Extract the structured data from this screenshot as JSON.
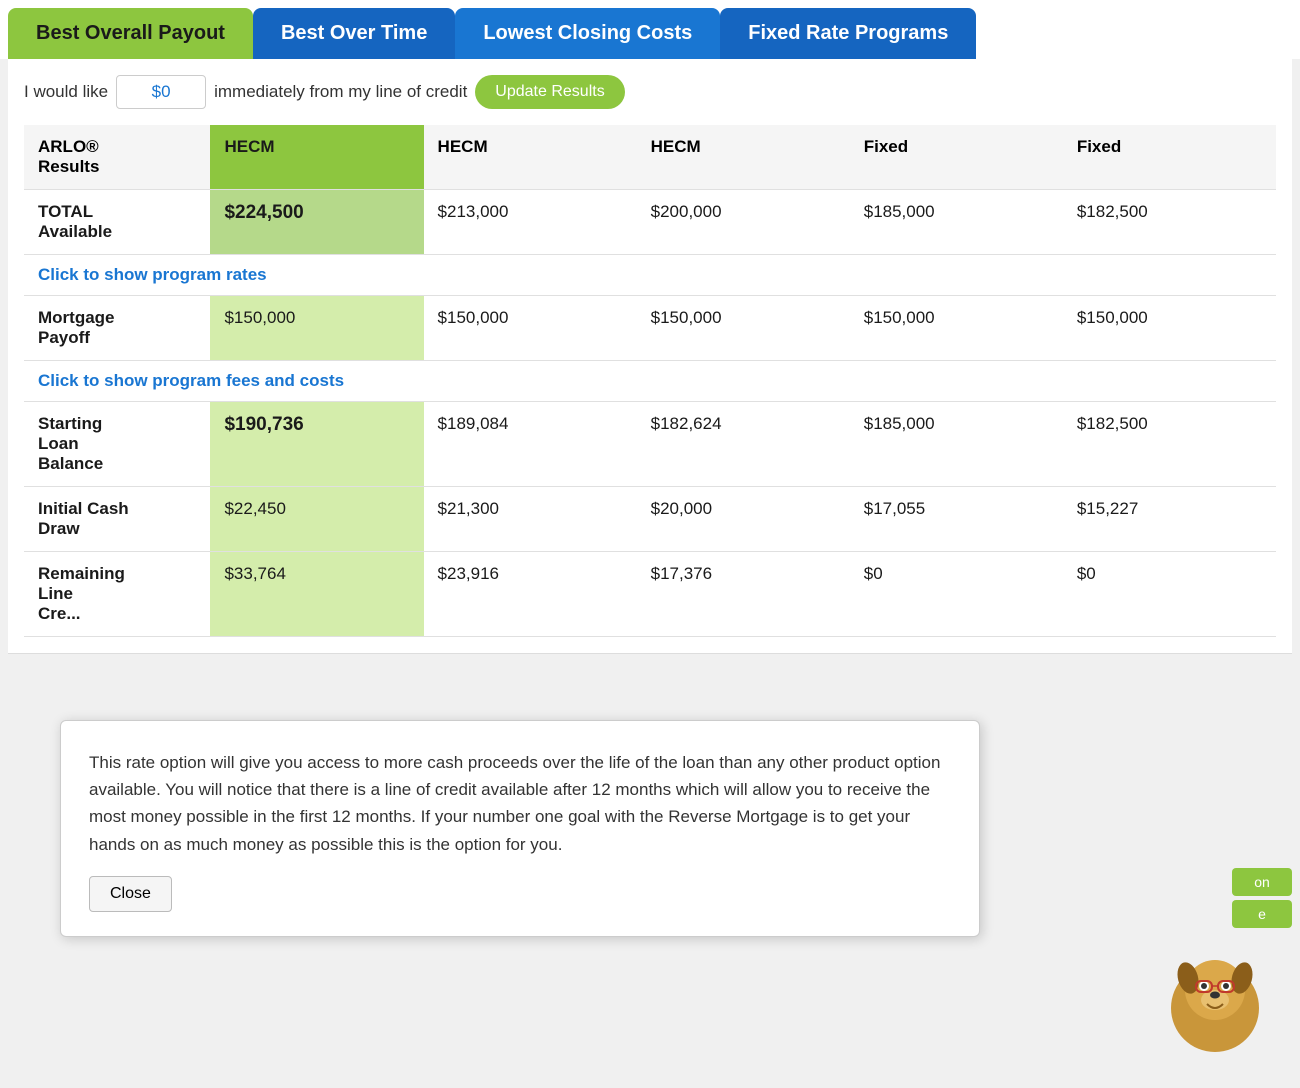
{
  "tabs": [
    {
      "id": "best-overall",
      "label": "Best Overall Payout",
      "style": "green",
      "active": true
    },
    {
      "id": "best-overtime",
      "label": "Best Over Time",
      "style": "blue"
    },
    {
      "id": "lowest-closing",
      "label": "Lowest Closing Costs",
      "style": "blue2"
    },
    {
      "id": "fixed-rate",
      "label": "Fixed Rate Programs",
      "style": "blue3"
    }
  ],
  "input_row": {
    "prefix": "I would like",
    "value": "$0",
    "suffix": "immediately from my line of credit",
    "button_label": "Update Results"
  },
  "table": {
    "headers": [
      {
        "id": "arlo-results",
        "label": "ARLO®\nResults",
        "highlight": false
      },
      {
        "id": "hecm-1",
        "label": "HECM",
        "highlight": true
      },
      {
        "id": "hecm-2",
        "label": "HECM",
        "highlight": false
      },
      {
        "id": "hecm-3",
        "label": "HECM",
        "highlight": false
      },
      {
        "id": "fixed-1",
        "label": "Fixed",
        "highlight": false
      },
      {
        "id": "fixed-2",
        "label": "Fixed",
        "highlight": false
      }
    ],
    "rows": [
      {
        "type": "data",
        "label": "TOTAL\nAvailable",
        "cells": [
          {
            "value": "$224,500",
            "highlight": true,
            "bold": true
          },
          {
            "value": "$213,000",
            "highlight": false
          },
          {
            "value": "$200,000",
            "highlight": false
          },
          {
            "value": "$185,000",
            "highlight": false
          },
          {
            "value": "$182,500",
            "highlight": false
          }
        ]
      },
      {
        "type": "link",
        "label": "Click to show program rates",
        "colspan": 6
      },
      {
        "type": "data",
        "label": "Mortgage\nPayoff",
        "cells": [
          {
            "value": "$150,000",
            "highlight": true
          },
          {
            "value": "$150,000",
            "highlight": false
          },
          {
            "value": "$150,000",
            "highlight": false
          },
          {
            "value": "$150,000",
            "highlight": false
          },
          {
            "value": "$150,000",
            "highlight": false
          }
        ]
      },
      {
        "type": "link",
        "label": "Click to show program fees and costs",
        "colspan": 6
      },
      {
        "type": "data",
        "label": "Starting\nLoan\nBalance",
        "cells": [
          {
            "value": "$190,736",
            "highlight": true,
            "bold": true
          },
          {
            "value": "$189,084",
            "highlight": false
          },
          {
            "value": "$182,624",
            "highlight": false
          },
          {
            "value": "$185,000",
            "highlight": false
          },
          {
            "value": "$182,500",
            "highlight": false
          }
        ]
      },
      {
        "type": "data",
        "label": "Initial Cash\nDraw",
        "cells": [
          {
            "value": "$22,450",
            "highlight": true
          },
          {
            "value": "$21,300",
            "highlight": false
          },
          {
            "value": "$20,000",
            "highlight": false
          },
          {
            "value": "$17,055",
            "highlight": false
          },
          {
            "value": "$15,227",
            "highlight": false
          }
        ]
      },
      {
        "type": "data",
        "label": "Remaining\nLine\nCre...",
        "cells": [
          {
            "value": "$33,764",
            "highlight": true
          },
          {
            "value": "$23,916",
            "highlight": false
          },
          {
            "value": "$17,376",
            "highlight": false
          },
          {
            "value": "$0",
            "highlight": false
          },
          {
            "value": "$0",
            "highlight": false
          }
        ]
      }
    ]
  },
  "popup": {
    "text": "This rate option will give you access to more cash proceeds over the life of the loan than any other product option available. You will notice that there is a line of credit available after 12 months which will allow you to receive the most money possible in the first 12 months. If your number one goal with the Reverse Mortgage is to get your hands on as much money as possible this is the option for you.",
    "close_label": "Close"
  }
}
